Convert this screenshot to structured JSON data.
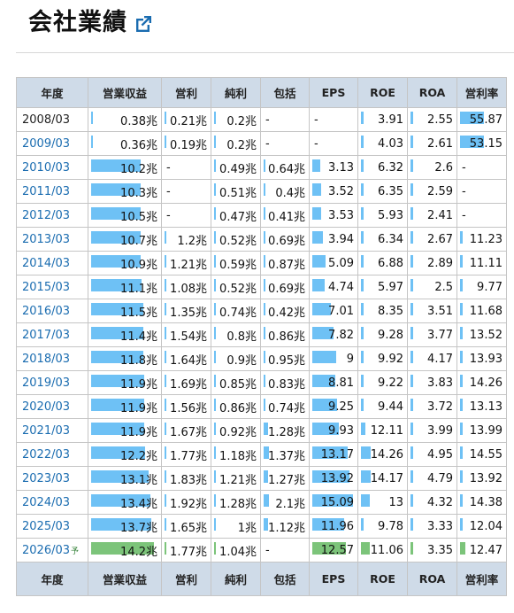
{
  "page": {
    "title": "会社業績",
    "link_icon": "external-link-icon"
  },
  "colors": {
    "header_bg": "#cfdbe8",
    "bar_blue": "#6ec1f5",
    "bar_green": "#7cc47a",
    "link": "#1a6cb0"
  },
  "table": {
    "columns": [
      "年度",
      "営業収益",
      "営利",
      "純利",
      "包括",
      "EPS",
      "ROE",
      "ROA",
      "営利率"
    ],
    "rows": [
      {
        "year": "2008/03",
        "link": false,
        "forecast": false,
        "cells": [
          {
            "t": "0.38兆",
            "b": 0.03
          },
          {
            "t": "0.21兆",
            "b": 0.03
          },
          {
            "t": "0.2兆",
            "b": 0.03
          },
          {
            "t": "-",
            "b": 0
          },
          {
            "t": "-",
            "b": 0
          },
          {
            "t": "3.91",
            "b": 0.06
          },
          {
            "t": "2.55",
            "b": 0.06
          },
          {
            "t": "55.87",
            "b": 0.56
          }
        ]
      },
      {
        "year": "2009/03",
        "link": true,
        "forecast": false,
        "cells": [
          {
            "t": "0.36兆",
            "b": 0.03
          },
          {
            "t": "0.19兆",
            "b": 0.03
          },
          {
            "t": "0.2兆",
            "b": 0.03
          },
          {
            "t": "-",
            "b": 0
          },
          {
            "t": "-",
            "b": 0
          },
          {
            "t": "4.03",
            "b": 0.06
          },
          {
            "t": "2.61",
            "b": 0.06
          },
          {
            "t": "53.15",
            "b": 0.56
          }
        ]
      },
      {
        "year": "2010/03",
        "link": true,
        "forecast": false,
        "cells": [
          {
            "t": "10.2兆",
            "b": 0.74
          },
          {
            "t": "-",
            "b": 0
          },
          {
            "t": "0.49兆",
            "b": 0.03
          },
          {
            "t": "0.64兆",
            "b": 0.03
          },
          {
            "t": "3.13",
            "b": 0.2
          },
          {
            "t": "6.32",
            "b": 0.06
          },
          {
            "t": "2.6",
            "b": 0.06
          },
          {
            "t": "-",
            "b": 0
          }
        ]
      },
      {
        "year": "2011/03",
        "link": true,
        "forecast": false,
        "cells": [
          {
            "t": "10.3兆",
            "b": 0.74
          },
          {
            "t": "-",
            "b": 0
          },
          {
            "t": "0.51兆",
            "b": 0.03
          },
          {
            "t": "0.4兆",
            "b": 0.03
          },
          {
            "t": "3.52",
            "b": 0.22
          },
          {
            "t": "6.35",
            "b": 0.06
          },
          {
            "t": "2.59",
            "b": 0.06
          },
          {
            "t": "-",
            "b": 0
          }
        ]
      },
      {
        "year": "2012/03",
        "link": true,
        "forecast": false,
        "cells": [
          {
            "t": "10.5兆",
            "b": 0.74
          },
          {
            "t": "-",
            "b": 0
          },
          {
            "t": "0.47兆",
            "b": 0.03
          },
          {
            "t": "0.41兆",
            "b": 0.03
          },
          {
            "t": "3.53",
            "b": 0.22
          },
          {
            "t": "5.93",
            "b": 0.06
          },
          {
            "t": "2.41",
            "b": 0.06
          },
          {
            "t": "-",
            "b": 0
          }
        ]
      },
      {
        "year": "2013/03",
        "link": true,
        "forecast": false,
        "cells": [
          {
            "t": "10.7兆",
            "b": 0.75
          },
          {
            "t": "1.2兆",
            "b": 0.05
          },
          {
            "t": "0.52兆",
            "b": 0.03
          },
          {
            "t": "0.69兆",
            "b": 0.03
          },
          {
            "t": "3.94",
            "b": 0.25
          },
          {
            "t": "6.34",
            "b": 0.06
          },
          {
            "t": "2.67",
            "b": 0.06
          },
          {
            "t": "11.23",
            "b": 0.06
          }
        ]
      },
      {
        "year": "2014/03",
        "link": true,
        "forecast": false,
        "cells": [
          {
            "t": "10.9兆",
            "b": 0.75
          },
          {
            "t": "1.21兆",
            "b": 0.05
          },
          {
            "t": "0.59兆",
            "b": 0.03
          },
          {
            "t": "0.87兆",
            "b": 0.05
          },
          {
            "t": "5.09",
            "b": 0.32
          },
          {
            "t": "6.88",
            "b": 0.06
          },
          {
            "t": "2.89",
            "b": 0.06
          },
          {
            "t": "11.11",
            "b": 0.06
          }
        ]
      },
      {
        "year": "2015/03",
        "link": true,
        "forecast": false,
        "cells": [
          {
            "t": "11.1兆",
            "b": 0.76
          },
          {
            "t": "1.08兆",
            "b": 0.05
          },
          {
            "t": "0.52兆",
            "b": 0.03
          },
          {
            "t": "0.69兆",
            "b": 0.03
          },
          {
            "t": "4.74",
            "b": 0.3
          },
          {
            "t": "5.97",
            "b": 0.06
          },
          {
            "t": "2.5",
            "b": 0.06
          },
          {
            "t": "9.77",
            "b": 0.06
          }
        ]
      },
      {
        "year": "2016/03",
        "link": true,
        "forecast": false,
        "cells": [
          {
            "t": "11.5兆",
            "b": 0.78
          },
          {
            "t": "1.35兆",
            "b": 0.05
          },
          {
            "t": "0.74兆",
            "b": 0.03
          },
          {
            "t": "0.42兆",
            "b": 0.03
          },
          {
            "t": "7.01",
            "b": 0.45
          },
          {
            "t": "8.35",
            "b": 0.06
          },
          {
            "t": "3.51",
            "b": 0.06
          },
          {
            "t": "11.68",
            "b": 0.06
          }
        ]
      },
      {
        "year": "2017/03",
        "link": true,
        "forecast": false,
        "cells": [
          {
            "t": "11.4兆",
            "b": 0.78
          },
          {
            "t": "1.54兆",
            "b": 0.05
          },
          {
            "t": "0.8兆",
            "b": 0.03
          },
          {
            "t": "0.86兆",
            "b": 0.05
          },
          {
            "t": "7.82",
            "b": 0.5
          },
          {
            "t": "9.28",
            "b": 0.06
          },
          {
            "t": "3.77",
            "b": 0.06
          },
          {
            "t": "13.52",
            "b": 0.06
          }
        ]
      },
      {
        "year": "2018/03",
        "link": true,
        "forecast": false,
        "cells": [
          {
            "t": "11.8兆",
            "b": 0.79
          },
          {
            "t": "1.64兆",
            "b": 0.05
          },
          {
            "t": "0.9兆",
            "b": 0.03
          },
          {
            "t": "0.95兆",
            "b": 0.05
          },
          {
            "t": "9",
            "b": 0.57
          },
          {
            "t": "9.92",
            "b": 0.06
          },
          {
            "t": "4.17",
            "b": 0.06
          },
          {
            "t": "13.93",
            "b": 0.06
          }
        ]
      },
      {
        "year": "2019/03",
        "link": true,
        "forecast": false,
        "cells": [
          {
            "t": "11.9兆",
            "b": 0.8
          },
          {
            "t": "1.69兆",
            "b": 0.05
          },
          {
            "t": "0.85兆",
            "b": 0.03
          },
          {
            "t": "0.83兆",
            "b": 0.05
          },
          {
            "t": "8.81",
            "b": 0.56
          },
          {
            "t": "9.22",
            "b": 0.06
          },
          {
            "t": "3.83",
            "b": 0.06
          },
          {
            "t": "14.26",
            "b": 0.06
          }
        ]
      },
      {
        "year": "2020/03",
        "link": true,
        "forecast": false,
        "cells": [
          {
            "t": "11.9兆",
            "b": 0.8
          },
          {
            "t": "1.56兆",
            "b": 0.05
          },
          {
            "t": "0.86兆",
            "b": 0.03
          },
          {
            "t": "0.74兆",
            "b": 0.05
          },
          {
            "t": "9.25",
            "b": 0.59
          },
          {
            "t": "9.44",
            "b": 0.06
          },
          {
            "t": "3.72",
            "b": 0.06
          },
          {
            "t": "13.13",
            "b": 0.06
          }
        ]
      },
      {
        "year": "2021/03",
        "link": true,
        "forecast": false,
        "cells": [
          {
            "t": "11.9兆",
            "b": 0.8
          },
          {
            "t": "1.67兆",
            "b": 0.05
          },
          {
            "t": "0.92兆",
            "b": 0.03
          },
          {
            "t": "1.28兆",
            "b": 0.1
          },
          {
            "t": "9.93",
            "b": 0.63
          },
          {
            "t": "12.11",
            "b": 0.1
          },
          {
            "t": "3.99",
            "b": 0.06
          },
          {
            "t": "13.99",
            "b": 0.06
          }
        ]
      },
      {
        "year": "2022/03",
        "link": true,
        "forecast": false,
        "cells": [
          {
            "t": "12.2兆",
            "b": 0.81
          },
          {
            "t": "1.77兆",
            "b": 0.05
          },
          {
            "t": "1.18兆",
            "b": 0.05
          },
          {
            "t": "1.37兆",
            "b": 0.12
          },
          {
            "t": "13.17",
            "b": 0.85
          },
          {
            "t": "14.26",
            "b": 0.22
          },
          {
            "t": "4.95",
            "b": 0.06
          },
          {
            "t": "14.55",
            "b": 0.06
          }
        ]
      },
      {
        "year": "2023/03",
        "link": true,
        "forecast": false,
        "cells": [
          {
            "t": "13.1兆",
            "b": 0.87
          },
          {
            "t": "1.83兆",
            "b": 0.05
          },
          {
            "t": "1.21兆",
            "b": 0.05
          },
          {
            "t": "1.27兆",
            "b": 0.1
          },
          {
            "t": "13.92",
            "b": 0.9
          },
          {
            "t": "14.17",
            "b": 0.22
          },
          {
            "t": "4.79",
            "b": 0.06
          },
          {
            "t": "13.92",
            "b": 0.06
          }
        ]
      },
      {
        "year": "2024/03",
        "link": true,
        "forecast": false,
        "cells": [
          {
            "t": "13.4兆",
            "b": 0.89
          },
          {
            "t": "1.92兆",
            "b": 0.05
          },
          {
            "t": "1.28兆",
            "b": 0.05
          },
          {
            "t": "2.1兆",
            "b": 0.12
          },
          {
            "t": "15.09",
            "b": 0.97
          },
          {
            "t": "13",
            "b": 0.2
          },
          {
            "t": "4.32",
            "b": 0.06
          },
          {
            "t": "14.38",
            "b": 0.06
          }
        ]
      },
      {
        "year": "2025/03",
        "link": true,
        "forecast": false,
        "cells": [
          {
            "t": "13.7兆",
            "b": 0.91
          },
          {
            "t": "1.65兆",
            "b": 0.05
          },
          {
            "t": "1兆",
            "b": 0.05
          },
          {
            "t": "1.12兆",
            "b": 0.1
          },
          {
            "t": "11.96",
            "b": 0.77
          },
          {
            "t": "9.78",
            "b": 0.06
          },
          {
            "t": "3.33",
            "b": 0.06
          },
          {
            "t": "12.04",
            "b": 0.06
          }
        ]
      },
      {
        "year": "2026/03",
        "link": true,
        "forecast": true,
        "forecast_mark": "予",
        "cells": [
          {
            "t": "14.2兆",
            "b": 0.94
          },
          {
            "t": "1.77兆",
            "b": 0.05
          },
          {
            "t": "1.04兆",
            "b": 0.05
          },
          {
            "t": "-",
            "b": 0
          },
          {
            "t": "12.57",
            "b": 0.81
          },
          {
            "t": "11.06",
            "b": 0.2
          },
          {
            "t": "3.35",
            "b": 0.06
          },
          {
            "t": "12.47",
            "b": 0.12
          }
        ]
      }
    ]
  }
}
